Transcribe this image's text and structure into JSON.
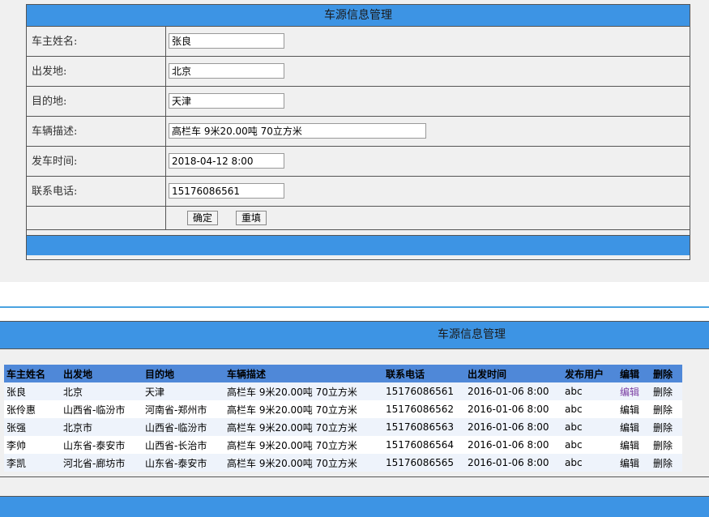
{
  "form": {
    "title": "车源信息管理",
    "fields": [
      {
        "label": "车主姓名:",
        "value": "张良"
      },
      {
        "label": "出发地:",
        "value": "北京"
      },
      {
        "label": "目的地:",
        "value": "天津"
      },
      {
        "label": "车辆描述:",
        "value": "高栏车 9米20.00吨 70立方米"
      },
      {
        "label": "发车时间:",
        "value": "2018-04-12 8:00"
      },
      {
        "label": "联系电话:",
        "value": "15176086561"
      }
    ],
    "confirm_label": "确定",
    "reset_label": "重填"
  },
  "list": {
    "title": "车源信息管理",
    "columns": [
      "车主姓名",
      "出发地",
      "目的地",
      "车辆描述",
      "联系电话",
      "出发时间",
      "发布用户",
      "编辑",
      "删除"
    ],
    "rows": [
      {
        "owner": "张良",
        "from": "北京",
        "to": "天津",
        "desc": "高栏车 9米20.00吨 70立方米",
        "phone": "15176086561",
        "time": "2016-01-06 8:00",
        "user": "abc",
        "edit": "编辑",
        "delete": "删除"
      },
      {
        "owner": "张伶惠",
        "from": "山西省-临汾市",
        "to": "河南省-郑州市",
        "desc": "高栏车 9米20.00吨 70立方米",
        "phone": "15176086562",
        "time": "2016-01-06 8:00",
        "user": "abc",
        "edit": "编辑",
        "delete": "删除"
      },
      {
        "owner": "张强",
        "from": "北京市",
        "to": "山西省-临汾市",
        "desc": "高栏车 9米20.00吨 70立方米",
        "phone": "15176086563",
        "time": "2016-01-06 8:00",
        "user": "abc",
        "edit": "编辑",
        "delete": "删除"
      },
      {
        "owner": "李帅",
        "from": "山东省-泰安市",
        "to": "山西省-长治市",
        "desc": "高栏车 9米20.00吨 70立方米",
        "phone": "15176086564",
        "time": "2016-01-06 8:00",
        "user": "abc",
        "edit": "编辑",
        "delete": "删除"
      },
      {
        "owner": "李凯",
        "from": "河北省-廊坊市",
        "to": "山东省-泰安市",
        "desc": "高栏车 9米20.00吨 70立方米",
        "phone": "15176086565",
        "time": "2016-01-06 8:00",
        "user": "abc",
        "edit": "编辑",
        "delete": "删除"
      }
    ]
  }
}
